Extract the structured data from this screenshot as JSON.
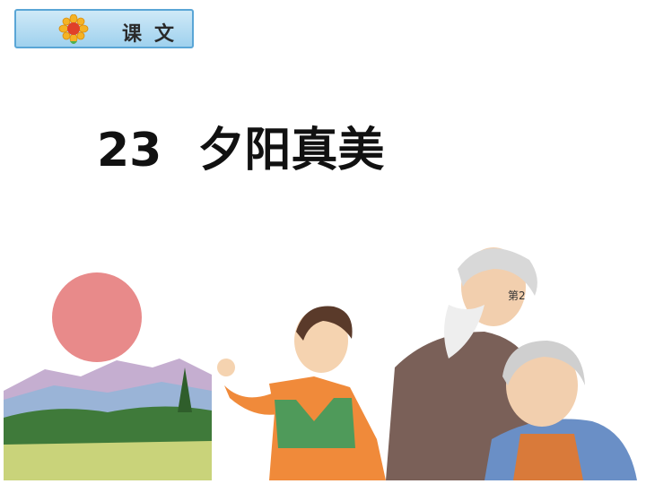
{
  "header": {
    "tag_label": "课文",
    "tag_icon": "sunflower-icon"
  },
  "lesson": {
    "number": "23",
    "title": "夕阳真美"
  },
  "illustration": {
    "caption": "第2"
  },
  "colors": {
    "tag_bg": "#aed8f1",
    "tag_border": "#5aa6d6",
    "sun": "#e88a8a",
    "title": "#111111"
  }
}
